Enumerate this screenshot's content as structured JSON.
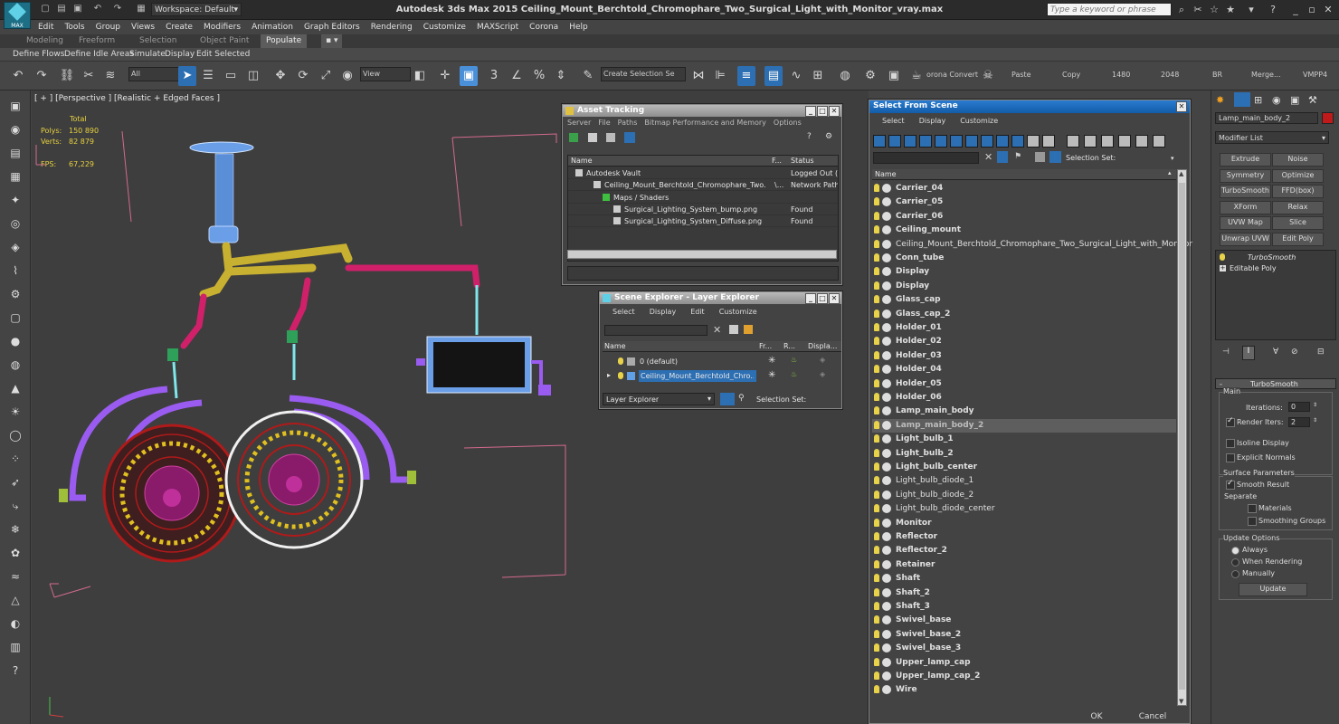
{
  "app": {
    "logo_text": "MAX",
    "title": "Autodesk 3ds Max  2015     Ceiling_Mount_Berchtold_Chromophare_Two_Surgical_Light_with_Monitor_vray.max",
    "workspace": "Workspace: Default",
    "search_placeholder": "Type a keyword or phrase"
  },
  "menu": [
    "Edit",
    "Tools",
    "Group",
    "Views",
    "Create",
    "Modifiers",
    "Animation",
    "Graph Editors",
    "Rendering",
    "Customize",
    "MAXScript",
    "Corona",
    "Help"
  ],
  "ribbon": {
    "tabs": [
      "Modeling",
      "Freeform",
      "Selection",
      "Object Paint",
      "Populate"
    ],
    "active_tab": "Populate",
    "row": [
      "Define Flows",
      "Define Idle Areas",
      "Simulate",
      "Display",
      "Edit Selected"
    ]
  },
  "toolbar": {
    "filter": "All",
    "view": "View",
    "selection_set": "Create Selection Se",
    "corona_convert": "orona Convert",
    "paste": "Paste",
    "copy": "Copy",
    "res_w": "1480",
    "res_h": "2048",
    "br": "BR",
    "merge": "Merge...",
    "vmpp": "VMPP4"
  },
  "viewport": {
    "label": "[ + ] [Perspective ] [Realistic + Edged Faces ]",
    "stats": {
      "total": "Total",
      "polys_label": "Polys:",
      "polys": "150 890",
      "verts_label": "Verts:",
      "verts": "82 879",
      "fps_label": "FPS:",
      "fps": "67,229"
    }
  },
  "asset_tracking": {
    "title": "Asset Tracking",
    "menu": [
      "Server",
      "File",
      "Paths",
      "Bitmap Performance and Memory",
      "Options"
    ],
    "columns": [
      "Name",
      "F...",
      "Status"
    ],
    "rows": [
      {
        "name": "Autodesk Vault",
        "f": "",
        "status": "Logged Out (..."
      },
      {
        "name": "Ceiling_Mount_Berchtold_Chromophare_Two...",
        "f": "\\...",
        "status": "Network Path"
      },
      {
        "name": "Maps / Shaders",
        "f": "",
        "status": ""
      },
      {
        "name": "Surgical_Lighting_System_bump.png",
        "f": "",
        "status": "Found"
      },
      {
        "name": "Surgical_Lighting_System_Diffuse.png",
        "f": "",
        "status": "Found"
      }
    ]
  },
  "scene_explorer": {
    "title": "Scene Explorer - Layer Explorer",
    "menu": [
      "Select",
      "Display",
      "Edit",
      "Customize"
    ],
    "columns": [
      "Name",
      "Fr...",
      "R...",
      "Displa..."
    ],
    "rows": [
      "0 (default)",
      "Ceiling_Mount_Berchtold_Chro..."
    ],
    "footer_left": "Layer Explorer",
    "footer_right": "Selection Set:"
  },
  "select_from_scene": {
    "title": "Select From Scene",
    "menu": [
      "Select",
      "Display",
      "Customize"
    ],
    "selection_set": "Selection Set:",
    "column": "Name",
    "items": [
      {
        "name": "Carrier_04",
        "bold": true
      },
      {
        "name": "Carrier_05",
        "bold": true
      },
      {
        "name": "Carrier_06",
        "bold": true
      },
      {
        "name": "Ceiling_mount",
        "bold": true
      },
      {
        "name": "Ceiling_Mount_Berchtold_Chromophare_Two_Surgical_Light_with_Monitor",
        "bold": false
      },
      {
        "name": "Conn_tube",
        "bold": true
      },
      {
        "name": "Display",
        "bold": true
      },
      {
        "name": "Display",
        "bold": true
      },
      {
        "name": "Glass_cap",
        "bold": true
      },
      {
        "name": "Glass_cap_2",
        "bold": true
      },
      {
        "name": "Holder_01",
        "bold": true
      },
      {
        "name": "Holder_02",
        "bold": true
      },
      {
        "name": "Holder_03",
        "bold": true
      },
      {
        "name": "Holder_04",
        "bold": true
      },
      {
        "name": "Holder_05",
        "bold": true
      },
      {
        "name": "Holder_06",
        "bold": true
      },
      {
        "name": "Lamp_main_body",
        "bold": true
      },
      {
        "name": "Lamp_main_body_2",
        "bold": true,
        "selected": true
      },
      {
        "name": "Light_bulb_1",
        "bold": true
      },
      {
        "name": "Light_bulb_2",
        "bold": true
      },
      {
        "name": "Light_bulb_center",
        "bold": true
      },
      {
        "name": "Light_bulb_diode_1",
        "bold": false
      },
      {
        "name": "Light_bulb_diode_2",
        "bold": false
      },
      {
        "name": "Light_bulb_diode_center",
        "bold": false
      },
      {
        "name": "Monitor",
        "bold": true
      },
      {
        "name": "Reflector",
        "bold": true
      },
      {
        "name": "Reflector_2",
        "bold": true
      },
      {
        "name": "Retainer",
        "bold": true
      },
      {
        "name": "Shaft",
        "bold": true
      },
      {
        "name": "Shaft_2",
        "bold": true
      },
      {
        "name": "Shaft_3",
        "bold": true
      },
      {
        "name": "Swivel_base",
        "bold": true
      },
      {
        "name": "Swivel_base_2",
        "bold": true
      },
      {
        "name": "Swivel_base_3",
        "bold": true
      },
      {
        "name": "Upper_lamp_cap",
        "bold": true
      },
      {
        "name": "Upper_lamp_cap_2",
        "bold": true
      },
      {
        "name": "Wire",
        "bold": true
      }
    ],
    "ok": "OK",
    "cancel": "Cancel"
  },
  "command_panel": {
    "object_name": "Lamp_main_body_2",
    "object_color": "#c01a1a",
    "modifier_list": "Modifier List",
    "buttons": [
      "Extrude",
      "Noise",
      "Symmetry",
      "Optimize",
      "TurboSmooth",
      "FFD(box)",
      "XForm",
      "Relax",
      "UVW Map",
      "Slice",
      "Unwrap UVW",
      "Edit Poly"
    ],
    "stack": [
      "TurboSmooth",
      "Editable Poly"
    ],
    "rollout_title": "TurboSmooth",
    "main_label": "Main",
    "iterations_label": "Iterations:",
    "iterations": "0",
    "render_iters_label": "Render Iters:",
    "render_iters": "2",
    "isoline": "Isoline Display",
    "explicit": "Explicit Normals",
    "surface_params": "Surface Parameters",
    "smooth_result": "Smooth Result",
    "separate": "Separate",
    "materials": "Materials",
    "smoothing_groups": "Smoothing Groups",
    "update_options": "Update Options",
    "always": "Always",
    "when_rendering": "When Rendering",
    "manually": "Manually",
    "update": "Update"
  },
  "colors": {
    "accent": "#2d6fb3",
    "wire_blue": "#6a9fe8",
    "wire_yellow": "#c8b030",
    "wire_pink": "#d0206a",
    "wire_purple": "#9a5cf0",
    "wire_red": "#b01a1a",
    "wire_white": "#f0f0f0",
    "stats_yellow": "#e8d13f"
  }
}
